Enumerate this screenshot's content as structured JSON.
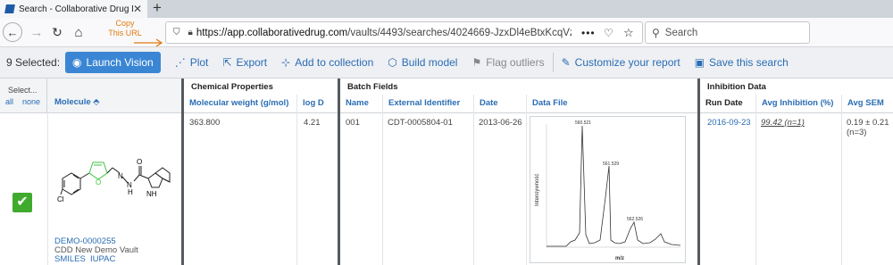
{
  "browser": {
    "tab_title": "Search - Collaborative Drug Di",
    "new_tab": "+",
    "annotation": "Copy This URL",
    "url_host": "https://app.collaborativedrug.com",
    "url_path": "/vaults/4493/searches/4024669-JzxDl4eBtxKcqVzi_-hYr",
    "search_placeholder": "Search"
  },
  "toolbar": {
    "selected": "9 Selected:",
    "launch_vision": "Launch Vision",
    "plot": "Plot",
    "export": "Export",
    "add_to_collection": "Add to collection",
    "build_model": "Build model",
    "flag_outliers": "Flag outliers",
    "customize_report": "Customize your report",
    "save_search": "Save this search"
  },
  "table": {
    "select_title": "Select...",
    "select_all": "all",
    "select_none": "none",
    "molecule_header": "Molecule",
    "groups": {
      "chemical_properties": "Chemical Properties",
      "batch_fields": "Batch Fields",
      "inhibition_data": "Inhibition Data"
    },
    "columns": {
      "mw": "Molecular weight (g/mol)",
      "logd": "log D",
      "name": "Name",
      "external_id": "External Identifier",
      "date": "Date",
      "data_file": "Data File",
      "run_date": "Run Date",
      "avg_inhibition": "Avg Inhibition (%)",
      "avg_sem": "Avg SEM"
    },
    "row": {
      "mw": "363.800",
      "logd": "4.21",
      "name": "001",
      "external_id": "CDT-0005804-01",
      "date": "2013-06-26",
      "run_date": "2016-09-23",
      "avg_inhibition": "99.42 (n=1)",
      "avg_sem": "0.19 ± 0.21",
      "avg_sem_n": "(n=3)",
      "molecule_id": "DEMO-0000255",
      "vault": "CDD New Demo Vault",
      "smiles": "SMILES",
      "iupac": "IUPAC"
    },
    "spectrum": {
      "peak1": "560.521",
      "peak2": "561.529",
      "peak3": "562.526",
      "ylabel": "Intensywność",
      "xlabel": "m/z"
    },
    "molecule_labels": {
      "cl": "Cl",
      "o_furan": "O",
      "n1": "N",
      "n2": "N",
      "h": "H",
      "o_carbonyl": "O",
      "nh": "NH"
    }
  },
  "colors": {
    "accent": "#2a6db5",
    "launch_bg": "#3b86d4",
    "check_bg": "#3faa2e",
    "annotation": "#e07a10",
    "furan_green": "#3ec63e"
  }
}
